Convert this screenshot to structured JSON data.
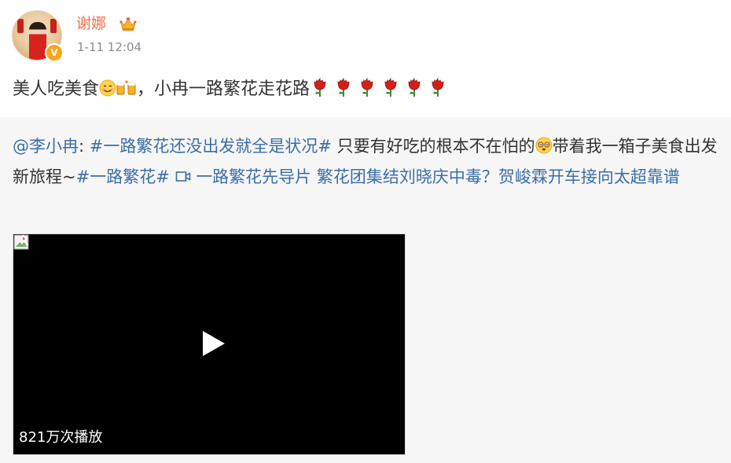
{
  "post": {
    "author": {
      "name": "谢娜",
      "avatar_icon": "avatar-portrait",
      "badge_icon": "verified-v-icon",
      "badge_text": "V",
      "badge_color": "#f9a51c",
      "crown_icon": "crown-icon"
    },
    "timestamp": "1-11 12:04",
    "text_part1": "美人吃美食",
    "text_part2": "，小冉一路繁花走花路",
    "emojis": [
      "smile-emoji",
      "beer-cheers-emoji"
    ],
    "rose_count_icon": "rose-emoji"
  },
  "repost": {
    "mention": "@李小冉",
    "colon": ":",
    "topic1": "#一路繁花还没出发就全是状况#",
    "text1": "只要有好吃的根本不在怕的",
    "emoji": "dizzy-eyes-emoji",
    "text2": "带着我一箱子美食出发新旅程~",
    "topic2": "#一路繁花#",
    "video_link": "一路繁花先导片 繁花团集结刘晓庆中毒？贺峻霖开车接向太超靠谱",
    "video": {
      "play_count": "821万次播放",
      "play_icon": "play-icon",
      "placeholder_icon": "broken-image-icon"
    }
  },
  "colors": {
    "username": "#eb7350",
    "link": "#3b6ea6",
    "repost_bg": "#f6f6f6"
  }
}
